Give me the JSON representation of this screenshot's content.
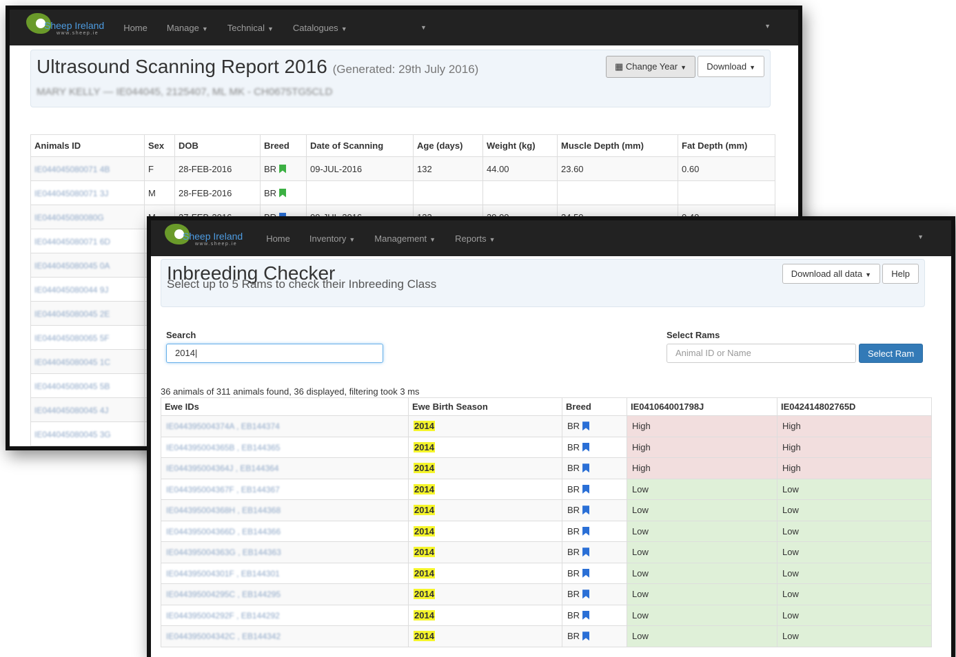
{
  "brand": {
    "name": "Sheep Ireland",
    "url": "www.sheep.ie"
  },
  "window1": {
    "nav": [
      "Home",
      "Manage",
      "Technical",
      "Catalogues"
    ],
    "title": "Ultrasound Scanning Report 2016",
    "generated": "(Generated: 29th July 2016)",
    "subtitle": "MARY KELLY — IE044045, 2125407, ML MK - CH0675TG5CLD",
    "buttons": {
      "change_year": "Change Year",
      "download": "Download"
    },
    "columns": [
      "Animals ID",
      "Sex",
      "DOB",
      "Breed",
      "Date of Scanning",
      "Age (days)",
      "Weight (kg)",
      "Muscle Depth (mm)",
      "Fat Depth (mm)"
    ],
    "rows": [
      {
        "id": "IE044045080071 4B",
        "sex": "F",
        "dob": "28-FEB-2016",
        "breed": "BR",
        "flag": "green",
        "scan": "09-JUL-2016",
        "age": "132",
        "weight": "44.00",
        "muscle": "23.60",
        "fat": "0.60"
      },
      {
        "id": "IE044045080071 3J",
        "sex": "M",
        "dob": "28-FEB-2016",
        "breed": "BR",
        "flag": "green",
        "scan": "",
        "age": "",
        "weight": "",
        "muscle": "",
        "fat": ""
      },
      {
        "id": "IE044045080080G",
        "sex": "M",
        "dob": "27-FEB-2016",
        "breed": "BR",
        "flag": "blue",
        "scan": "09-JUL-2016",
        "age": "133",
        "weight": "39.00",
        "muscle": "24.50",
        "fat": "0.40"
      },
      {
        "id": "IE044045080071 6D"
      },
      {
        "id": "IE044045080045 0A"
      },
      {
        "id": "IE044045080044 9J"
      },
      {
        "id": "IE044045080045 2E"
      },
      {
        "id": "IE044045080065 5F"
      },
      {
        "id": "IE044045080045 1C"
      },
      {
        "id": "IE044045080045 5B"
      },
      {
        "id": "IE044045080045 4J"
      },
      {
        "id": "IE044045080045 3G"
      }
    ]
  },
  "window2": {
    "nav": [
      "Home",
      "Inventory",
      "Management",
      "Reports"
    ],
    "title": "Inbreeding Checker",
    "subtitle": "Select up to 5 Rams to check their Inbreeding Class",
    "buttons": {
      "download_all": "Download all data",
      "help": "Help",
      "select_ram": "Select Ram"
    },
    "search_label": "Search",
    "search_value": "2014",
    "rams_label": "Select Rams",
    "rams_placeholder": "Animal ID or Name",
    "status": "36 animals of 311 animals found, 36 displayed, filtering took 3 ms",
    "columns": [
      "Ewe IDs",
      "Ewe Birth Season",
      "Breed",
      "IE041064001798J",
      "IE042414802765D"
    ],
    "rows": [
      {
        "id": "IE044395004374A , EB144374",
        "season": "2014",
        "breed": "BR",
        "r1": "High",
        "r2": "High"
      },
      {
        "id": "IE044395004365B , EB144365",
        "season": "2014",
        "breed": "BR",
        "r1": "High",
        "r2": "High"
      },
      {
        "id": "IE044395004364J , EB144364",
        "season": "2014",
        "breed": "BR",
        "r1": "High",
        "r2": "High"
      },
      {
        "id": "IE044395004367F , EB144367",
        "season": "2014",
        "breed": "BR",
        "r1": "Low",
        "r2": "Low"
      },
      {
        "id": "IE044395004368H , EB144368",
        "season": "2014",
        "breed": "BR",
        "r1": "Low",
        "r2": "Low"
      },
      {
        "id": "IE044395004366D , EB144366",
        "season": "2014",
        "breed": "BR",
        "r1": "Low",
        "r2": "Low"
      },
      {
        "id": "IE044395004363G , EB144363",
        "season": "2014",
        "breed": "BR",
        "r1": "Low",
        "r2": "Low"
      },
      {
        "id": "IE044395004301F , EB144301",
        "season": "2014",
        "breed": "BR",
        "r1": "Low",
        "r2": "Low"
      },
      {
        "id": "IE044395004295C , EB144295",
        "season": "2014",
        "breed": "BR",
        "r1": "Low",
        "r2": "Low"
      },
      {
        "id": "IE044395004292F , EB144292",
        "season": "2014",
        "breed": "BR",
        "r1": "Low",
        "r2": "Low"
      },
      {
        "id": "IE044395004342C , EB144342",
        "season": "2014",
        "breed": "BR",
        "r1": "Low",
        "r2": "Low"
      }
    ]
  }
}
